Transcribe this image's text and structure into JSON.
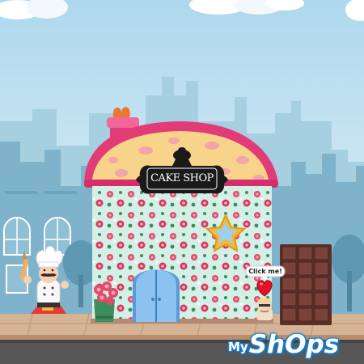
{
  "scene": {
    "sign_text": "CAKE SHOP",
    "click_hint": "Click me!",
    "logo": {
      "prefix": "My",
      "main": "ShOps"
    }
  },
  "icons": {
    "chef": "chef-icon",
    "heart": "heart-icon",
    "star": "star-window-icon",
    "door": "door-icon",
    "chocolate": "chocolate-bar-icon",
    "flowers": "flower-bouquet-icon",
    "helper": "helper-character-icon"
  },
  "colors": {
    "sky": "#cfe6f2",
    "skyline": "#7fb3cc",
    "roof": "#e23c78",
    "sidewalk": "#d6b394",
    "road": "#555555",
    "logo_blue": "#1b86d6",
    "chocolate": "#6e3e36"
  }
}
